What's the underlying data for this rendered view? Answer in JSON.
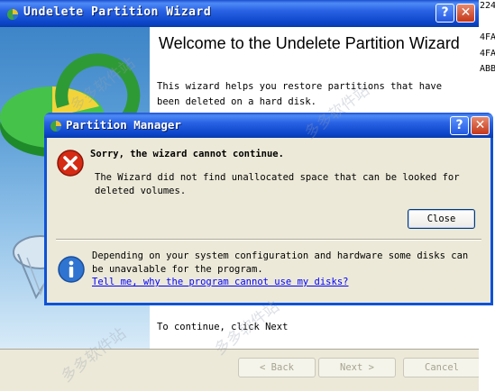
{
  "background_window": {
    "title": "Undelete Partition Wizard",
    "heading": "Welcome to the Undelete Partition Wizard",
    "description": "This wizard helps you restore partitions that have been deleted on a hard disk.",
    "continue_text": "To continue, click Next",
    "buttons": {
      "back": "< Back",
      "next": "Next >",
      "cancel": "Cancel"
    },
    "title_buttons": {
      "help": "?",
      "close": "✕"
    }
  },
  "right_strip": [
    "224",
    "4FA",
    "4FA",
    "ABB"
  ],
  "dialog": {
    "title": "Partition Manager",
    "title_buttons": {
      "help": "?",
      "close": "✕"
    },
    "error_title": "Sorry, the wizard cannot continue.",
    "error_message": "The Wizard did not find unallocated space that can be looked for deleted volumes.",
    "close_button": "Close",
    "info_text": "Depending on your system configuration and hardware some disks can be unavalable for the program.",
    "info_link": "Tell me, why the program cannot use my disks?"
  },
  "icons": {
    "error": "error-icon",
    "info": "info-icon",
    "app": "partition-manager-icon"
  },
  "colors": {
    "titlebar": "#0b44c8",
    "dialog_face": "#ece9d8",
    "link": "#0000ff",
    "error_red": "#d52a14",
    "info_blue": "#2f74d0"
  }
}
